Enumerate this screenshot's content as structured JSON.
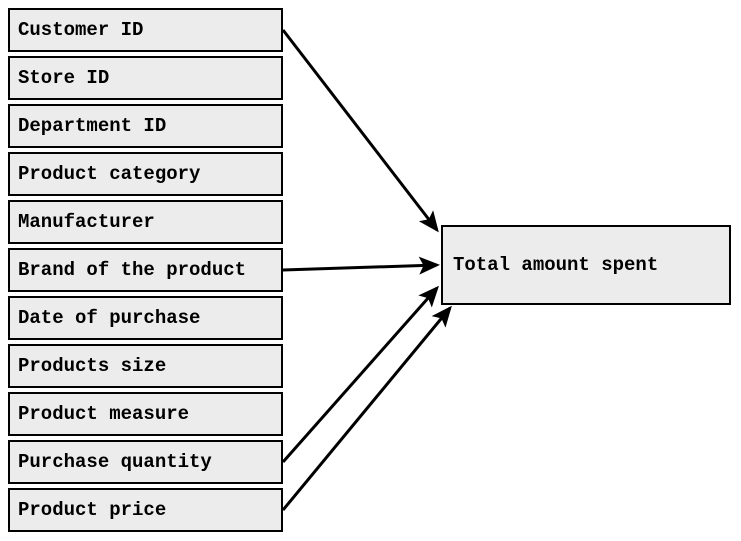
{
  "inputs": [
    {
      "label": "Customer ID"
    },
    {
      "label": "Store ID"
    },
    {
      "label": "Department ID"
    },
    {
      "label": "Product category"
    },
    {
      "label": "Manufacturer"
    },
    {
      "label": "Brand of the product"
    },
    {
      "label": "Date of purchase"
    },
    {
      "label": "Products size"
    },
    {
      "label": "Product measure"
    },
    {
      "label": "Purchase quantity"
    },
    {
      "label": "Product price"
    }
  ],
  "output": {
    "label": "Total amount spent"
  },
  "arrows": [
    {
      "from_index": 0
    },
    {
      "from_index": 5
    },
    {
      "from_index": 9
    },
    {
      "from_index": 10
    }
  ]
}
